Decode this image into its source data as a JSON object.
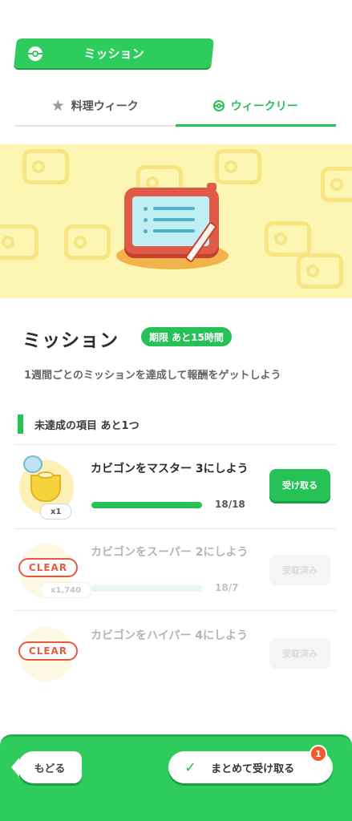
{
  "header": {
    "title": "ミッション"
  },
  "tabs": [
    {
      "label": "料理ウィーク",
      "active": false,
      "icon": "star-icon"
    },
    {
      "label": "ウィークリー",
      "active": true,
      "icon": "pokeball-icon"
    }
  ],
  "section": {
    "title": "ミッション",
    "deadline": "期限 あと15時間",
    "description": "1週間ごとのミッションを達成して報酬をゲットしよう"
  },
  "pending": {
    "label": "未達成の項目 あと1つ"
  },
  "missions": [
    {
      "text": "カビゴンをマスター 3にしよう",
      "progress_label": "18/18",
      "progress": 1.0,
      "reward_qty": "x1",
      "button": "受け取る",
      "status": "claimable"
    },
    {
      "text": "カビゴンをスーパー 2にしよう",
      "progress_label": "18/7",
      "progress": 1.0,
      "reward_qty": "x1,740",
      "badge": "CLEAR",
      "button": "受取済み",
      "status": "received"
    },
    {
      "text": "カビゴンをハイパー 4にしよう",
      "badge": "CLEAR",
      "button": "受取済み",
      "status": "received"
    }
  ],
  "footer": {
    "back": "もどる",
    "claim_all": "まとめて受け取る",
    "notification_count": "1"
  },
  "colors": {
    "accent": "#27c257",
    "clear": "#e85a3c",
    "hero_bg": "#fdf6b2",
    "badge": "#f05a2c"
  }
}
